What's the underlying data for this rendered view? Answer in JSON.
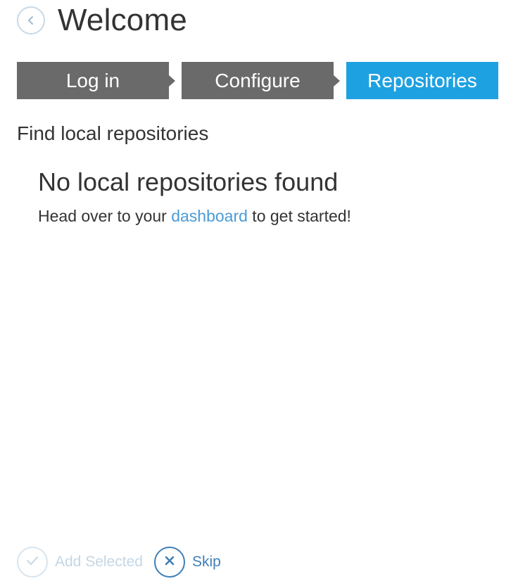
{
  "header": {
    "title": "Welcome",
    "back_icon": "chevron-left-icon"
  },
  "steps": [
    {
      "label": "Log in",
      "active": false
    },
    {
      "label": "Configure",
      "active": false
    },
    {
      "label": "Repositories",
      "active": true
    }
  ],
  "colors": {
    "step_inactive": "#6a6a6a",
    "step_active": "#1ea1e1",
    "link": "#4a9bd7",
    "skip": "#3d7fb8",
    "disabled": "#c4d6e4"
  },
  "main": {
    "section_title": "Find local repositories",
    "empty_title": "No local repositories found",
    "empty_text_before": "Head over to your ",
    "empty_link": "dashboard",
    "empty_text_after": " to get started!"
  },
  "footer": {
    "add_selected_label": "Add Selected",
    "add_selected_icon": "checkmark-icon",
    "add_selected_enabled": false,
    "skip_label": "Skip",
    "skip_icon": "close-icon"
  }
}
